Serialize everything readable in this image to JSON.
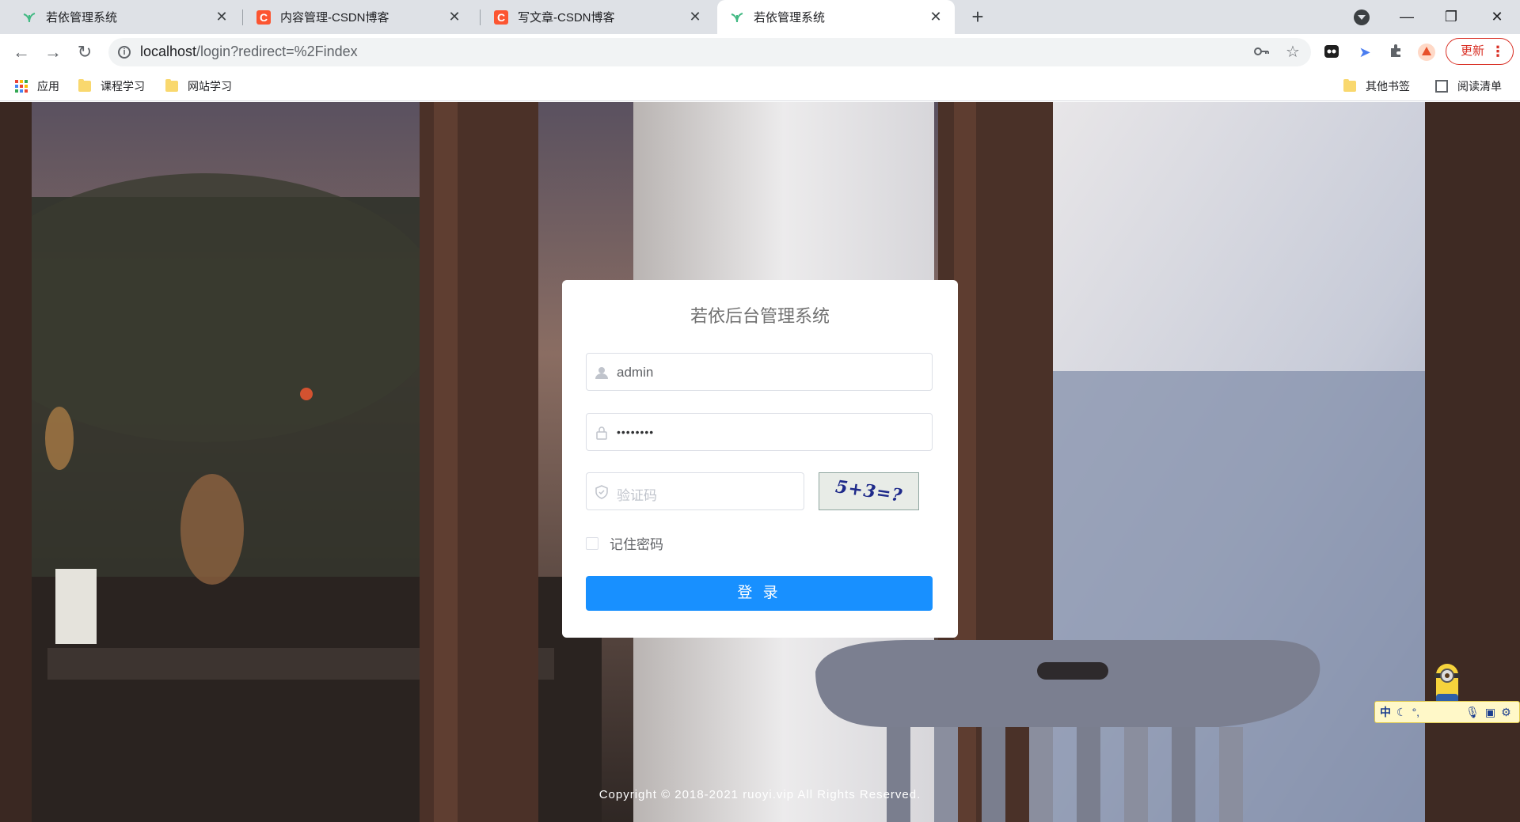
{
  "browser": {
    "tabs": [
      {
        "title": "若依管理系统",
        "favicon": "leaf-icon",
        "active": false
      },
      {
        "title": "内容管理-CSDN博客",
        "favicon": "csdn-icon",
        "active": false
      },
      {
        "title": "写文章-CSDN博客",
        "favicon": "csdn-icon",
        "active": false
      },
      {
        "title": "若依管理系统",
        "favicon": "leaf-icon",
        "active": true
      }
    ],
    "url_host": "localhost",
    "url_path": "/login?redirect=%2Findex",
    "update_label": "更新",
    "csdn_letter": "C"
  },
  "bookmarks": {
    "apps_label": "应用",
    "items": [
      "课程学习",
      "网站学习"
    ],
    "other_label": "其他书签",
    "reading_label": "阅读清单"
  },
  "login": {
    "title": "若依后台管理系统",
    "username_value": "admin",
    "password_mask": "••••••••",
    "captcha_placeholder": "验证码",
    "captcha_text": "5+3=?",
    "remember_label": "记住密码",
    "submit_label": "登 录"
  },
  "footer": {
    "copyright": "Copyright © 2018-2021 ruoyi.vip All Rights Reserved."
  },
  "ime": {
    "mode_label": "中"
  },
  "colors": {
    "primary": "#1890ff",
    "update_red": "#d93025",
    "csdn_red": "#fc5531"
  }
}
